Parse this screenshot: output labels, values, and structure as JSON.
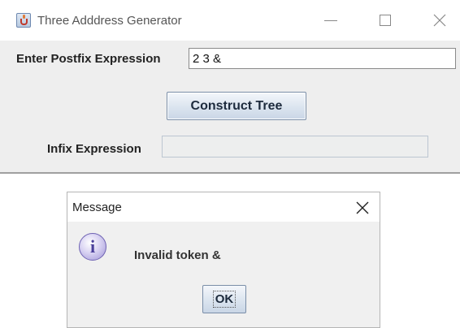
{
  "window": {
    "title": "Three Adddress Generator",
    "icon": "java-cup-icon",
    "controls": [
      "minimize-icon",
      "maximize-icon",
      "close-icon"
    ]
  },
  "form": {
    "postfix_label": "Enter Postfix Expression",
    "postfix_value": "2 3 &",
    "construct_button_label": "Construct Tree",
    "infix_label": "Infix Expression",
    "infix_value": ""
  },
  "dialog": {
    "title": "Message",
    "icon": "info-icon",
    "icon_glyph": "i",
    "message": "Invalid token &",
    "ok_label": "OK"
  },
  "colors": {
    "window_background": "#eeeeee",
    "button_gradient_top": "#f4f7fb",
    "button_gradient_bottom": "#c9d6e6",
    "info_icon": "#9f94d6"
  }
}
